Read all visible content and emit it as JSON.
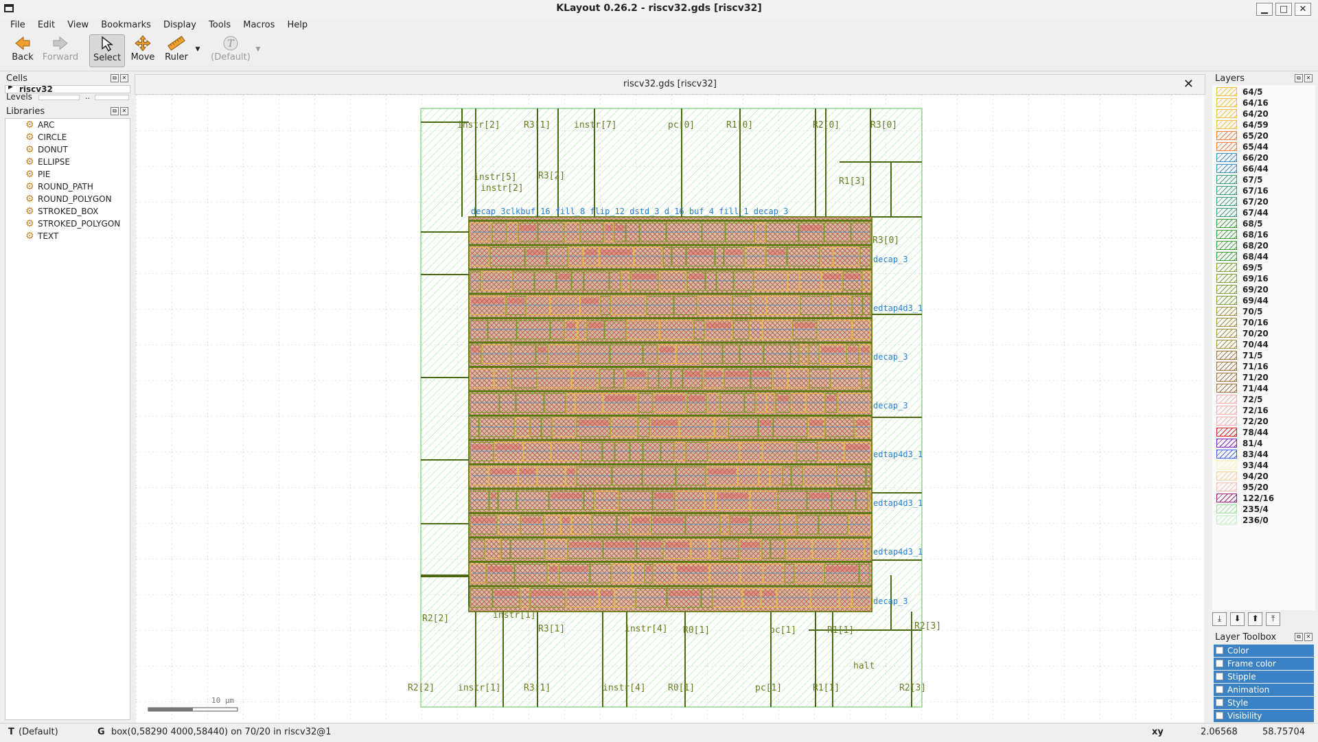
{
  "window": {
    "title": "KLayout 0.26.2 - riscv32.gds [riscv32]",
    "minimize": "▁",
    "maximize": "□",
    "close": "✕"
  },
  "menu": [
    "File",
    "Edit",
    "View",
    "Bookmarks",
    "Display",
    "Tools",
    "Macros",
    "Help"
  ],
  "toolbar": {
    "back": "Back",
    "forward": "Forward",
    "select": "Select",
    "move": "Move",
    "ruler": "Ruler",
    "default": "(Default)"
  },
  "cells": {
    "title": "Cells",
    "top_cell": "riscv32",
    "levels_label": "Levels",
    "levels_sep": ".."
  },
  "libraries": {
    "title": "Libraries",
    "items": [
      "ARC",
      "CIRCLE",
      "DONUT",
      "ELLIPSE",
      "PIE",
      "ROUND_PATH",
      "ROUND_POLYGON",
      "STROKED_BOX",
      "STROKED_POLYGON",
      "TEXT"
    ]
  },
  "tab": {
    "title": "riscv32.gds [riscv32]"
  },
  "layout_view": {
    "scale_label": "10 µm",
    "pin_labels_top": [
      "instr[2]",
      "R3[1]",
      "instr[7]",
      "pc[0]",
      "R1[0]",
      "R2[0]",
      "R3[0]"
    ],
    "pin_labels_upper": [
      "instr[5]",
      "instr[2]",
      "R3[2]",
      "R1[3]",
      "R3[0]"
    ],
    "cell_labels_right": [
      "decap_3",
      "decap_3",
      "decap_3",
      "decap_3"
    ],
    "cell_labels_right_blue": [
      "edtap4d3_1",
      "edtap4d3_1",
      "edtap4d3_1",
      "edtap4d3_1"
    ],
    "pin_labels_lower": [
      "R2[2]",
      "instr[1]",
      "R3[1]",
      "instr[4]",
      "R0[1]",
      "pc[1]",
      "R1[1]",
      "R2[3]"
    ],
    "pin_labels_bottom": [
      "R2[2]",
      "instr[1]",
      "R3[1]",
      "instr[4]",
      "R0[1]",
      "pc[1]",
      "R1[1]",
      "R2[3]"
    ],
    "halt_label": "halt",
    "top_blue_label": "decap_3clkbuf_16 fill_8 flip_12 dstd_3 d_16 buf_4 fill_1 decap_3"
  },
  "layers": {
    "title": "Layers",
    "items": [
      {
        "name": "64/5",
        "color": "#f0c040"
      },
      {
        "name": "64/16",
        "color": "#f0c040"
      },
      {
        "name": "64/20",
        "color": "#f0c040"
      },
      {
        "name": "64/59",
        "color": "#f0c040"
      },
      {
        "name": "65/20",
        "color": "#f08040"
      },
      {
        "name": "65/44",
        "color": "#f08040"
      },
      {
        "name": "66/20",
        "color": "#4090c0"
      },
      {
        "name": "66/44",
        "color": "#4090c0"
      },
      {
        "name": "67/5",
        "color": "#40a080"
      },
      {
        "name": "67/16",
        "color": "#40a080"
      },
      {
        "name": "67/20",
        "color": "#40a080"
      },
      {
        "name": "67/44",
        "color": "#40a080"
      },
      {
        "name": "68/5",
        "color": "#40a040"
      },
      {
        "name": "68/16",
        "color": "#40a040"
      },
      {
        "name": "68/20",
        "color": "#40a040"
      },
      {
        "name": "68/44",
        "color": "#40a040"
      },
      {
        "name": "69/5",
        "color": "#80a040"
      },
      {
        "name": "69/16",
        "color": "#80a040"
      },
      {
        "name": "69/20",
        "color": "#80a040"
      },
      {
        "name": "69/44",
        "color": "#80a040"
      },
      {
        "name": "70/5",
        "color": "#a09040"
      },
      {
        "name": "70/16",
        "color": "#a09040"
      },
      {
        "name": "70/20",
        "color": "#a09040"
      },
      {
        "name": "70/44",
        "color": "#a09040"
      },
      {
        "name": "71/5",
        "color": "#a07040"
      },
      {
        "name": "71/16",
        "color": "#a07040"
      },
      {
        "name": "71/20",
        "color": "#a07040"
      },
      {
        "name": "71/44",
        "color": "#a07040"
      },
      {
        "name": "72/5",
        "color": "#f0b0b0"
      },
      {
        "name": "72/16",
        "color": "#f0b0b0"
      },
      {
        "name": "72/20",
        "color": "#f0b0b0"
      },
      {
        "name": "78/44",
        "color": "#e02020"
      },
      {
        "name": "81/4",
        "color": "#8020c0"
      },
      {
        "name": "83/44",
        "color": "#4060f0"
      },
      {
        "name": "93/44",
        "color": "#f8f0c0"
      },
      {
        "name": "94/20",
        "color": "#f8d0a0"
      },
      {
        "name": "95/20",
        "color": "#f8c0b0"
      },
      {
        "name": "122/16",
        "color": "#a02080"
      },
      {
        "name": "235/4",
        "color": "#a0e0a0"
      },
      {
        "name": "236/0",
        "color": "#c0f0c0"
      }
    ]
  },
  "layer_toolbox": {
    "title": "Layer Toolbox",
    "items": [
      "Color",
      "Frame color",
      "Stipple",
      "Animation",
      "Style",
      "Visibility"
    ]
  },
  "status": {
    "mode_key": "T",
    "mode": "(Default)",
    "grid_key": "G",
    "message": "box(0,58290 4000,58440) on 70/20 in riscv32@1",
    "coord_key": "xy",
    "x": "2.06568",
    "y": "58.75704"
  }
}
